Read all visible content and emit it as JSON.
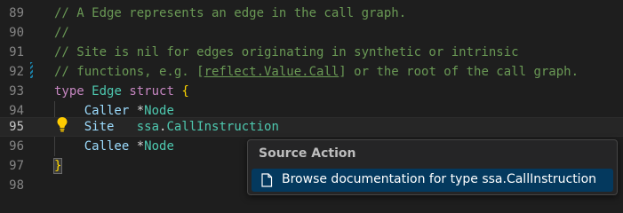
{
  "editor": {
    "lines": [
      {
        "number": "89",
        "text": "// A Edge represents an edge in the call graph."
      },
      {
        "number": "90",
        "text": "//"
      },
      {
        "number": "91",
        "text": "// Site is nil for edges originating in synthetic or intrinsic"
      },
      {
        "number": "92",
        "pre": "// functions, e.g. [",
        "link": "reflect.Value.Call",
        "post": "] or the root of the call graph."
      },
      {
        "number": "93",
        "kw": "type",
        "name": "Edge",
        "kw2": "struct",
        "brace": "{"
      },
      {
        "number": "94",
        "field": "Caller",
        "ptr": "*",
        "type": "Node"
      },
      {
        "number": "95",
        "field": "Site",
        "pkg": "ssa",
        "dot": ".",
        "type": "CallInstruction"
      },
      {
        "number": "96",
        "field": "Callee",
        "ptr": "*",
        "type": "Node"
      },
      {
        "number": "97",
        "brace": "}"
      },
      {
        "number": "98"
      }
    ]
  },
  "popup": {
    "header": "Source Action",
    "item_label": "Browse documentation for type ssa.CallInstruction",
    "item_icon": "file-icon"
  },
  "colors": {
    "background": "#1e1e1e",
    "comment": "#6a9955",
    "keyword": "#c586c0",
    "type": "#4ec9b0",
    "field": "#9cdcfe",
    "bracket": "#ffd700",
    "selection": "#04395e"
  },
  "icons": {
    "lightbulb": "lightbulb-icon",
    "modified_marker": "gutter-change-marker"
  }
}
